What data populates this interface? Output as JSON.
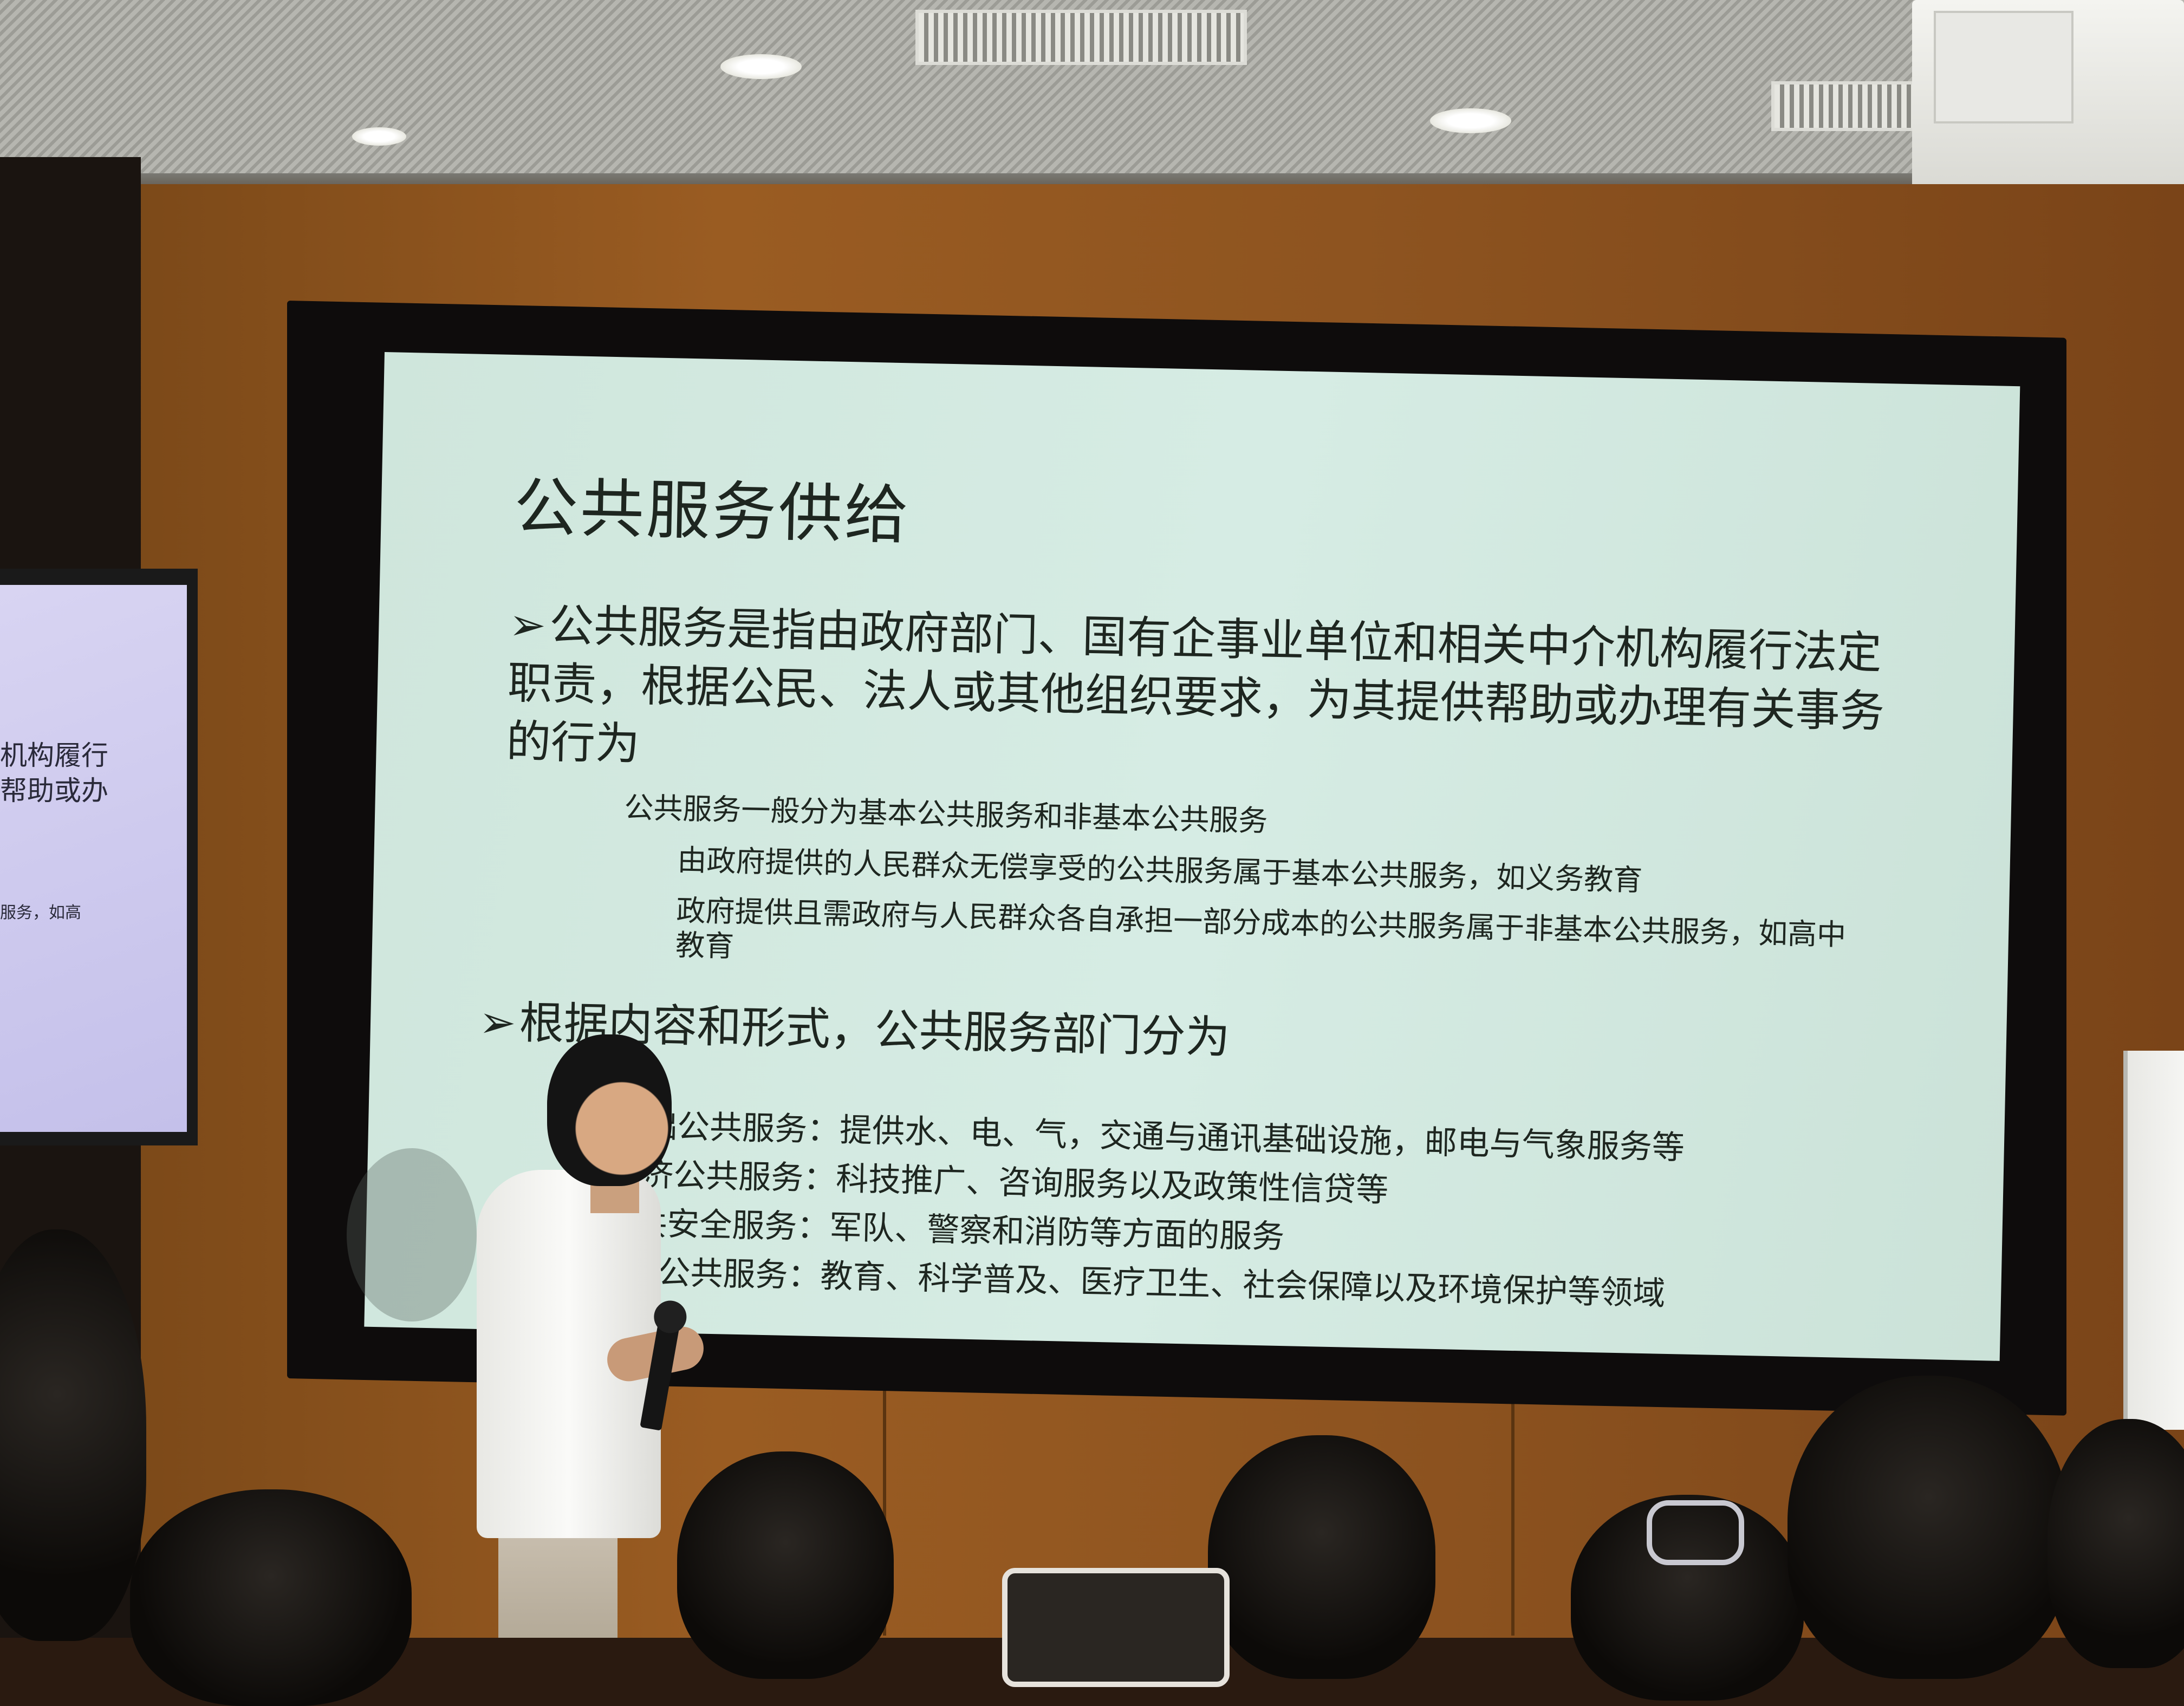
{
  "slide": {
    "title": "公共服务供给",
    "bullet1_arrow": "➢",
    "bullet1": "公共服务是指由政府部门、国有企事业单位和相关中介机构履行法定职责，根据公民、法人或其他组织要求，为其提供帮助或办理有关事务的行为",
    "sub1": "公共服务一般分为基本公共服务和非基本公共服务",
    "sub2": "由政府提供的人民群众无偿享受的公共服务属于基本公共服务，如义务教育",
    "sub3": "政府提供且需政府与人民群众各自承担一部分成本的公共服务属于非基本公共服务，如高中教育",
    "bullet2_arrow": "➢",
    "bullet2": "根据内容和形式，公共服务部门分为",
    "items": [
      "础公共服务：提供水、电、气，交通与通讯基础设施，邮电与气象服务等",
      "济公共服务：科技推广、咨询服务以及政策性信贷等",
      "共安全服务：军队、警察和消防等方面的服务",
      "社会公共服务：教育、科学普及、医疗卫生、社会保障以及环境保护等领域"
    ]
  },
  "side_monitor": {
    "lines": [
      "机构履行",
      "帮助或办",
      "服务，如高"
    ]
  },
  "colors": {
    "slide_bg": "#d2e8df",
    "wall": "#8e5420",
    "text": "#1e2620"
  }
}
